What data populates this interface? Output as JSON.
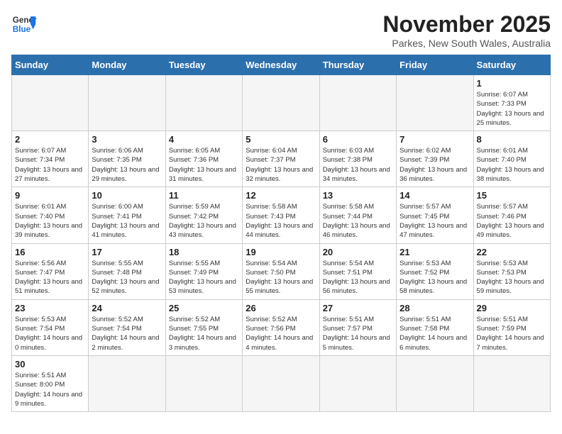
{
  "header": {
    "logo_general": "General",
    "logo_blue": "Blue",
    "month": "November 2025",
    "location": "Parkes, New South Wales, Australia"
  },
  "weekdays": [
    "Sunday",
    "Monday",
    "Tuesday",
    "Wednesday",
    "Thursday",
    "Friday",
    "Saturday"
  ],
  "weeks": [
    [
      {
        "day": "",
        "empty": true
      },
      {
        "day": "",
        "empty": true
      },
      {
        "day": "",
        "empty": true
      },
      {
        "day": "",
        "empty": true
      },
      {
        "day": "",
        "empty": true
      },
      {
        "day": "",
        "empty": true
      },
      {
        "day": "1",
        "sunrise": "6:07 AM",
        "sunset": "7:33 PM",
        "daylight": "13 hours and 25 minutes."
      }
    ],
    [
      {
        "day": "2",
        "sunrise": "6:07 AM",
        "sunset": "7:34 PM",
        "daylight": "13 hours and 27 minutes."
      },
      {
        "day": "3",
        "sunrise": "6:06 AM",
        "sunset": "7:35 PM",
        "daylight": "13 hours and 29 minutes."
      },
      {
        "day": "4",
        "sunrise": "6:05 AM",
        "sunset": "7:36 PM",
        "daylight": "13 hours and 31 minutes."
      },
      {
        "day": "5",
        "sunrise": "6:04 AM",
        "sunset": "7:37 PM",
        "daylight": "13 hours and 32 minutes."
      },
      {
        "day": "6",
        "sunrise": "6:03 AM",
        "sunset": "7:38 PM",
        "daylight": "13 hours and 34 minutes."
      },
      {
        "day": "7",
        "sunrise": "6:02 AM",
        "sunset": "7:39 PM",
        "daylight": "13 hours and 36 minutes."
      },
      {
        "day": "8",
        "sunrise": "6:01 AM",
        "sunset": "7:40 PM",
        "daylight": "13 hours and 38 minutes."
      }
    ],
    [
      {
        "day": "9",
        "sunrise": "6:01 AM",
        "sunset": "7:40 PM",
        "daylight": "13 hours and 39 minutes."
      },
      {
        "day": "10",
        "sunrise": "6:00 AM",
        "sunset": "7:41 PM",
        "daylight": "13 hours and 41 minutes."
      },
      {
        "day": "11",
        "sunrise": "5:59 AM",
        "sunset": "7:42 PM",
        "daylight": "13 hours and 43 minutes."
      },
      {
        "day": "12",
        "sunrise": "5:58 AM",
        "sunset": "7:43 PM",
        "daylight": "13 hours and 44 minutes."
      },
      {
        "day": "13",
        "sunrise": "5:58 AM",
        "sunset": "7:44 PM",
        "daylight": "13 hours and 46 minutes."
      },
      {
        "day": "14",
        "sunrise": "5:57 AM",
        "sunset": "7:45 PM",
        "daylight": "13 hours and 47 minutes."
      },
      {
        "day": "15",
        "sunrise": "5:57 AM",
        "sunset": "7:46 PM",
        "daylight": "13 hours and 49 minutes."
      }
    ],
    [
      {
        "day": "16",
        "sunrise": "5:56 AM",
        "sunset": "7:47 PM",
        "daylight": "13 hours and 51 minutes."
      },
      {
        "day": "17",
        "sunrise": "5:55 AM",
        "sunset": "7:48 PM",
        "daylight": "13 hours and 52 minutes."
      },
      {
        "day": "18",
        "sunrise": "5:55 AM",
        "sunset": "7:49 PM",
        "daylight": "13 hours and 53 minutes."
      },
      {
        "day": "19",
        "sunrise": "5:54 AM",
        "sunset": "7:50 PM",
        "daylight": "13 hours and 55 minutes."
      },
      {
        "day": "20",
        "sunrise": "5:54 AM",
        "sunset": "7:51 PM",
        "daylight": "13 hours and 56 minutes."
      },
      {
        "day": "21",
        "sunrise": "5:53 AM",
        "sunset": "7:52 PM",
        "daylight": "13 hours and 58 minutes."
      },
      {
        "day": "22",
        "sunrise": "5:53 AM",
        "sunset": "7:53 PM",
        "daylight": "13 hours and 59 minutes."
      }
    ],
    [
      {
        "day": "23",
        "sunrise": "5:53 AM",
        "sunset": "7:54 PM",
        "daylight": "14 hours and 0 minutes."
      },
      {
        "day": "24",
        "sunrise": "5:52 AM",
        "sunset": "7:54 PM",
        "daylight": "14 hours and 2 minutes."
      },
      {
        "day": "25",
        "sunrise": "5:52 AM",
        "sunset": "7:55 PM",
        "daylight": "14 hours and 3 minutes."
      },
      {
        "day": "26",
        "sunrise": "5:52 AM",
        "sunset": "7:56 PM",
        "daylight": "14 hours and 4 minutes."
      },
      {
        "day": "27",
        "sunrise": "5:51 AM",
        "sunset": "7:57 PM",
        "daylight": "14 hours and 5 minutes."
      },
      {
        "day": "28",
        "sunrise": "5:51 AM",
        "sunset": "7:58 PM",
        "daylight": "14 hours and 6 minutes."
      },
      {
        "day": "29",
        "sunrise": "5:51 AM",
        "sunset": "7:59 PM",
        "daylight": "14 hours and 7 minutes."
      }
    ],
    [
      {
        "day": "30",
        "sunrise": "5:51 AM",
        "sunset": "8:00 PM",
        "daylight": "14 hours and 9 minutes."
      },
      {
        "day": "",
        "empty": true
      },
      {
        "day": "",
        "empty": true
      },
      {
        "day": "",
        "empty": true
      },
      {
        "day": "",
        "empty": true
      },
      {
        "day": "",
        "empty": true
      },
      {
        "day": "",
        "empty": true
      }
    ]
  ]
}
